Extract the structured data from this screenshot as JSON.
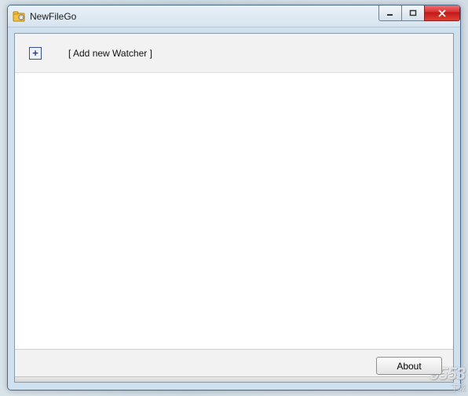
{
  "window": {
    "title": "NewFileGo"
  },
  "addRow": {
    "label": "[ Add new Watcher ]"
  },
  "footer": {
    "about_label": "About"
  },
  "watermark": {
    "text": "9553",
    "sub": "下载"
  }
}
